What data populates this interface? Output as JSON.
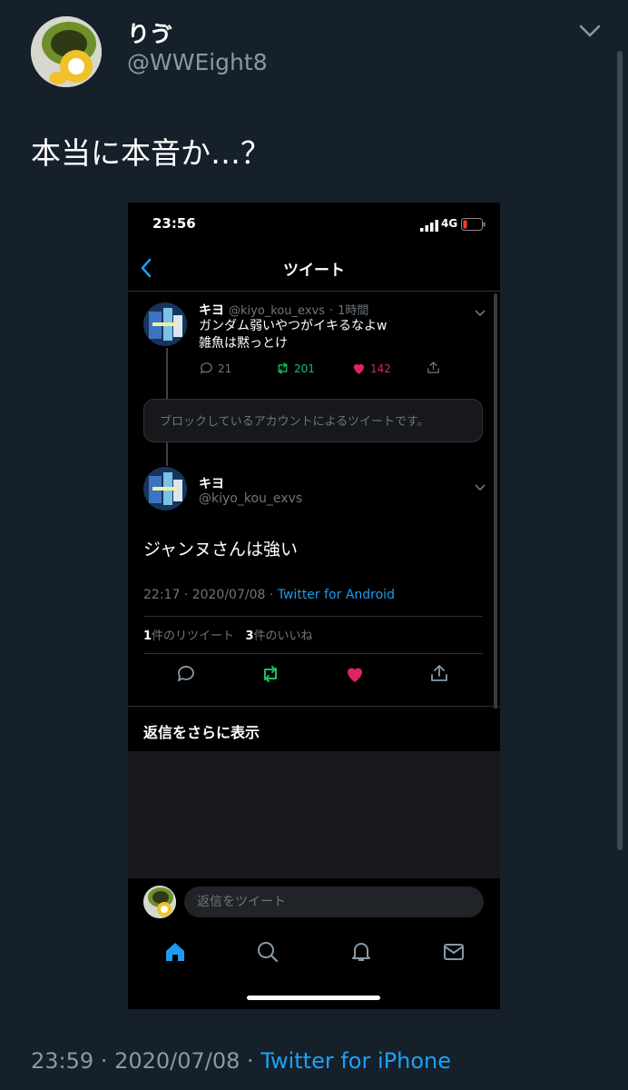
{
  "outer_tweet": {
    "display_name": "りゔ",
    "handle": "@WWEight8",
    "text": "本当に本音か…？",
    "time": "23:59",
    "date": "2020/07/08",
    "source": "Twitter for iPhone",
    "separator": " · "
  },
  "screenshot": {
    "status_bar": {
      "time": "23:56",
      "network": "4G"
    },
    "nav": {
      "title": "ツイート",
      "back_icon": "chevron-left-icon"
    },
    "parent_tweet": {
      "name": "キヨ",
      "handle": "@kiyo_kou_exvs",
      "age": "1時間",
      "dot": "·",
      "lines": [
        "ガンダム弱いやつがイキるなよw",
        "雑魚は黙っとけ"
      ],
      "replies": "21",
      "retweets": "201",
      "likes": "142"
    },
    "blocked_notice": "ブロックしているアカウントによるツイートです。",
    "main_tweet": {
      "name": "キヨ",
      "handle": "@kiyo_kou_exvs",
      "text": "ジャンヌさんは強い",
      "timestamp": "22:17 · 2020/07/08 · ",
      "source": "Twitter for Android",
      "retweet_count": "1",
      "retweet_label": "件のリツイート",
      "like_count": "3",
      "like_label": "件のいいね"
    },
    "more_replies": "返信をさらに表示",
    "compose_placeholder": "返信をツイート",
    "tabs": [
      "home-icon",
      "search-icon",
      "bell-icon",
      "mail-icon"
    ]
  },
  "colors": {
    "background": "#15202b",
    "accent": "#1da1f2",
    "retweet_green": "#17bf63",
    "like_red": "#e0245e",
    "muted": "#8899a6"
  }
}
